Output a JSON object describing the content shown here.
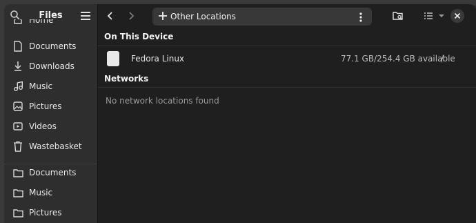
{
  "sidebar": {
    "title": "Files",
    "items": [
      {
        "label": "Home",
        "icon": "home-icon"
      },
      {
        "label": "Documents",
        "icon": "document-icon"
      },
      {
        "label": "Downloads",
        "icon": "download-icon"
      },
      {
        "label": "Music",
        "icon": "music-icon"
      },
      {
        "label": "Pictures",
        "icon": "image-icon"
      },
      {
        "label": "Videos",
        "icon": "video-icon"
      },
      {
        "label": "Wastebasket",
        "icon": "trash-icon"
      },
      {
        "label": "Documents",
        "icon": "folder-icon"
      },
      {
        "label": "Music",
        "icon": "folder-icon"
      },
      {
        "label": "Pictures",
        "icon": "folder-icon"
      }
    ]
  },
  "toolbar": {
    "path_label": "Other Locations"
  },
  "on_this_device": {
    "heading": "On This Device",
    "devices": [
      {
        "name": "Fedora Linux",
        "space": "77.1 GB/254.4 GB available",
        "mount": "/"
      }
    ]
  },
  "networks": {
    "heading": "Networks",
    "empty_text": "No network locations found"
  },
  "colors": {
    "window_bg": "#1f1f1f",
    "sidebar_bg": "#2e2e2e",
    "pathbar_bg": "#383838"
  }
}
